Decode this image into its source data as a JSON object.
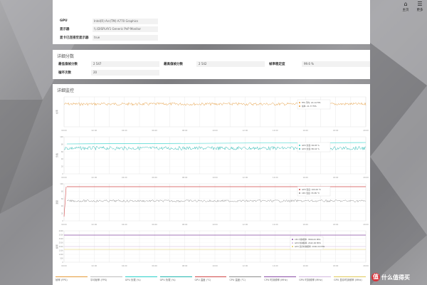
{
  "toolbar": {
    "home_label": "主页",
    "more_label": "更多"
  },
  "info": {
    "rows": [
      {
        "key": "GPU",
        "value": "Intel(R) Arc(TM) A770 Graphics"
      },
      {
        "key": "显示器",
        "value": "\\\\.\\DISPLAY1 Generic PnP Monitor"
      },
      {
        "key": "显卡已连接至显示器",
        "value": "true"
      }
    ]
  },
  "scores": {
    "title": "详细分数",
    "items": [
      {
        "key": "最低值帧分数",
        "value": "2 547"
      },
      {
        "key": "最高值帧分数",
        "value": "2 542"
      },
      {
        "key": "帧率稳定度",
        "value": "99.6 %"
      },
      {
        "key": "循环次数",
        "value": "20"
      }
    ]
  },
  "monitor": {
    "title": "详细监控",
    "charts": [
      {
        "name": "fps-chart",
        "ylabel": "帧率",
        "series": [
          {
            "color": "#e59a3a"
          },
          {
            "color": "#bdbdbd"
          }
        ],
        "legend": [
          {
            "label": "FPS 平均: 22.14 FPS",
            "color": "#e59a3a"
          },
          {
            "label": "帧率: 21.77 FPS",
            "color": "#e59a3a"
          }
        ],
        "xticks": [
          "00:00",
          "01:00",
          "02:00",
          "03:00",
          "04:00",
          "05:00",
          "06:00",
          "07:00",
          "08:00",
          "09:00",
          "10:00",
          "11:00",
          "12:00",
          "13:00",
          "14:00",
          "15:00",
          "16:00",
          "17:00",
          "18:00",
          "19:00",
          "20:00"
        ]
      },
      {
        "name": "gpu-util-chart",
        "ylabel": "负载",
        "series": [
          {
            "color": "#2ad1c9"
          },
          {
            "color": "#23b6b0"
          }
        ],
        "legend": [
          {
            "label": "GPU 负载: 99.95 %",
            "color": "#2ad1c9"
          },
          {
            "label": "GPU 负载: 86.44 %",
            "color": "#23b6b0"
          }
        ],
        "yticks": [
          "100",
          "80",
          "60",
          "40",
          "20",
          "0"
        ],
        "xticks": [
          "00:00",
          "01:00",
          "02:00",
          "03:00",
          "04:00",
          "05:00",
          "06:00",
          "07:00",
          "08:00",
          "09:00",
          "10:00",
          "11:00",
          "12:00",
          "13:00",
          "14:00",
          "15:00",
          "16:00",
          "17:00",
          "18:00",
          "19:00",
          "20:00"
        ]
      },
      {
        "name": "temp-chart",
        "ylabel": "温度",
        "series": [
          {
            "color": "#d14848"
          },
          {
            "color": "#8c8c8c"
          }
        ],
        "legend": [
          {
            "label": "GPU 温度: 100.00 ℃",
            "color": "#d14848"
          },
          {
            "label": "CPU 温度: 55.85 ℃",
            "color": "#8c8c8c"
          }
        ],
        "yticks": [
          "100",
          "80",
          "60",
          "40",
          "20",
          "0"
        ],
        "xticks": [
          "00:00",
          "01:00",
          "02:00",
          "03:00",
          "04:00",
          "05:00",
          "06:00",
          "07:00",
          "08:00",
          "09:00",
          "10:00",
          "11:00",
          "12:00",
          "13:00",
          "14:00",
          "15:00",
          "16:00",
          "17:00",
          "18:00",
          "19:00",
          "20:00"
        ]
      },
      {
        "name": "clock-chart",
        "ylabel": "频率",
        "series": [
          {
            "color": "#8b4ea6"
          },
          {
            "color": "#d3b8e0"
          },
          {
            "color": "#e0c95a"
          }
        ],
        "legend": [
          {
            "label": "CPU 时钟频率: 3566.00 MHz",
            "color": "#8b4ea6"
          },
          {
            "label": "GPU 时钟频率: 2442.00 MHz",
            "color": "#d3b8e0"
          },
          {
            "label": "GPU 显存时钟频率: 2000.00 MHz",
            "color": "#e0c95a"
          }
        ],
        "yticks": [
          "4000",
          "3500",
          "3000",
          "2500",
          "2000",
          "1500",
          "1000",
          "500",
          "0"
        ],
        "xticks": [
          "00:00",
          "01:00",
          "02:00",
          "03:00",
          "04:00",
          "05:00",
          "06:00",
          "07:00",
          "08:00",
          "09:00",
          "10:00",
          "11:00",
          "12:00",
          "13:00",
          "14:00",
          "15:00",
          "16:00",
          "17:00",
          "18:00",
          "19:00",
          "20:00"
        ]
      }
    ],
    "bottom_legend": [
      {
        "label": "帧率 (FPS)",
        "color": "#e59a3a"
      },
      {
        "label": "平均帧率 (FPS)",
        "color": "#bdbdbd"
      },
      {
        "label": "GPU 负载 (%)",
        "color": "#2ad1c9"
      },
      {
        "label": "GPU 负载 (%)",
        "color": "#23b6b0"
      },
      {
        "label": "GPU 温度 (°C)",
        "color": "#d14848"
      },
      {
        "label": "CPU 温度 (°C)",
        "color": "#8c8c8c"
      },
      {
        "label": "CPU 时钟频率 (MHz)",
        "color": "#8b4ea6"
      },
      {
        "label": "GPU 时钟频率 (MHz)",
        "color": "#d3b8e0"
      },
      {
        "label": "GPU 显存时钟频率 (MHz)",
        "color": "#e0c95a"
      }
    ]
  },
  "watermark": {
    "logo_char": "值",
    "text": "什么值得买"
  }
}
